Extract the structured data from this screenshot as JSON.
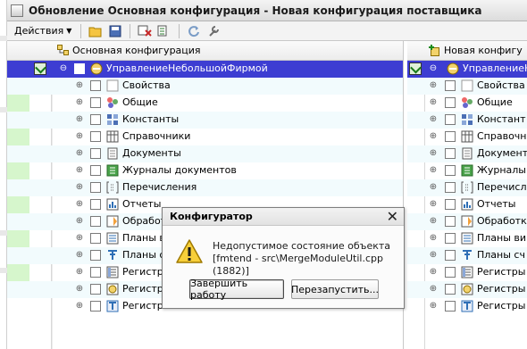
{
  "window": {
    "title": "Обновление Основная конфигурация - Новая конфигурация поставщика"
  },
  "toolbar": {
    "actions_label": "Действия",
    "buttons": [
      "open-icon",
      "save-icon",
      "filter-icon",
      "compare-icon",
      "refresh-icon",
      "settings-icon"
    ]
  },
  "left_pane": {
    "header": "Основная конфигурация",
    "root": "УправлениеНебольшойФирмой",
    "items": [
      "Свойства",
      "Общие",
      "Константы",
      "Справочники",
      "Документы",
      "Журналы документов",
      "Перечисления",
      "Отчеты",
      "Обработ",
      "Планы в",
      "Планы с",
      "Регистры",
      "Регистры",
      "Регистр"
    ]
  },
  "right_pane": {
    "header": "Новая конфигу",
    "root": "УправлениеН",
    "items": [
      "Свойства",
      "Общие",
      "Констант",
      "Справочн",
      "Документ",
      "Журналы",
      "Перечисл",
      "Отчеты",
      "Обработк",
      "Планы ви",
      "Планы сч",
      "Регистры",
      "Регистры",
      "Регистры"
    ]
  },
  "dialog": {
    "title": "Конфигуратор",
    "message_line1": "Недопустимое состояние объекта",
    "message_line2": "[fmtend - src\\MergeModuleUtil.cpp (1882)]",
    "btn_finish": "Завершить работу",
    "btn_restart": "Перезапустить..."
  },
  "colors": {
    "selection": "#3d3dd2",
    "changed": "#b8f0a8",
    "warning": "#f0c419"
  }
}
